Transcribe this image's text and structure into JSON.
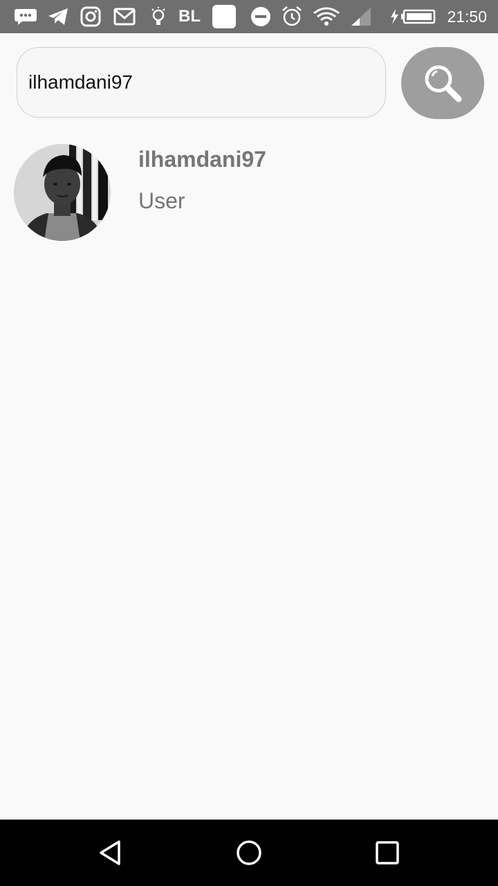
{
  "status_bar": {
    "bl_text": "BL",
    "time": "21:50",
    "icons": [
      "messenger-icon",
      "telegram-icon",
      "instagram-icon",
      "gmail-icon",
      "bulb-icon",
      "blank-app-icon",
      "dnd-icon",
      "alarm-icon",
      "wifi-icon",
      "signal-icon",
      "battery-charging-icon"
    ]
  },
  "search": {
    "value": "ilhamdani97",
    "button_icon": "search-icon"
  },
  "results": [
    {
      "name": "ilhamdani97",
      "role": "User",
      "avatar": "avatar"
    }
  ],
  "nav": {
    "icons": [
      "back-icon",
      "home-icon",
      "recents-icon"
    ]
  }
}
